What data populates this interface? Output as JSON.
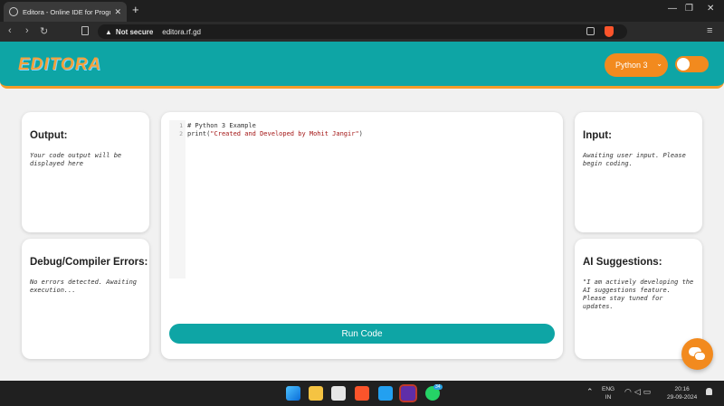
{
  "browser": {
    "tab_title": "Editora - Online IDE for Programmers",
    "security_label": "Not secure",
    "url": "editora.rf.gd"
  },
  "header": {
    "logo_text": "EDITORA",
    "language_selected": "Python 3",
    "theme_toggle_on": false
  },
  "output": {
    "title": "Output:",
    "text": "Your code output will be displayed here"
  },
  "debug": {
    "title": "Debug/Compiler Errors:",
    "text": "No errors detected. Awaiting execution..."
  },
  "input": {
    "title": "Input:",
    "text": "Awaiting user input. Please begin coding."
  },
  "ai": {
    "title": "AI Suggestions:",
    "text": "\"I am actively developing the AI suggestions feature. Please stay tuned for updates."
  },
  "editor": {
    "line_numbers": [
      "1",
      "2"
    ],
    "line1": "# Python 3 Example",
    "line2_func": "print(",
    "line2_str": "\"Created and Developed by Mohit Jangir\"",
    "line2_end": ")",
    "run_label": "Run Code"
  },
  "taskbar": {
    "lang_line1": "ENG",
    "lang_line2": "IN",
    "time": "20:16",
    "date": "29-09-2024",
    "whatsapp_badge": "34"
  },
  "colors": {
    "accent_teal": "#0ea5a5",
    "accent_orange": "#f28a1e"
  }
}
